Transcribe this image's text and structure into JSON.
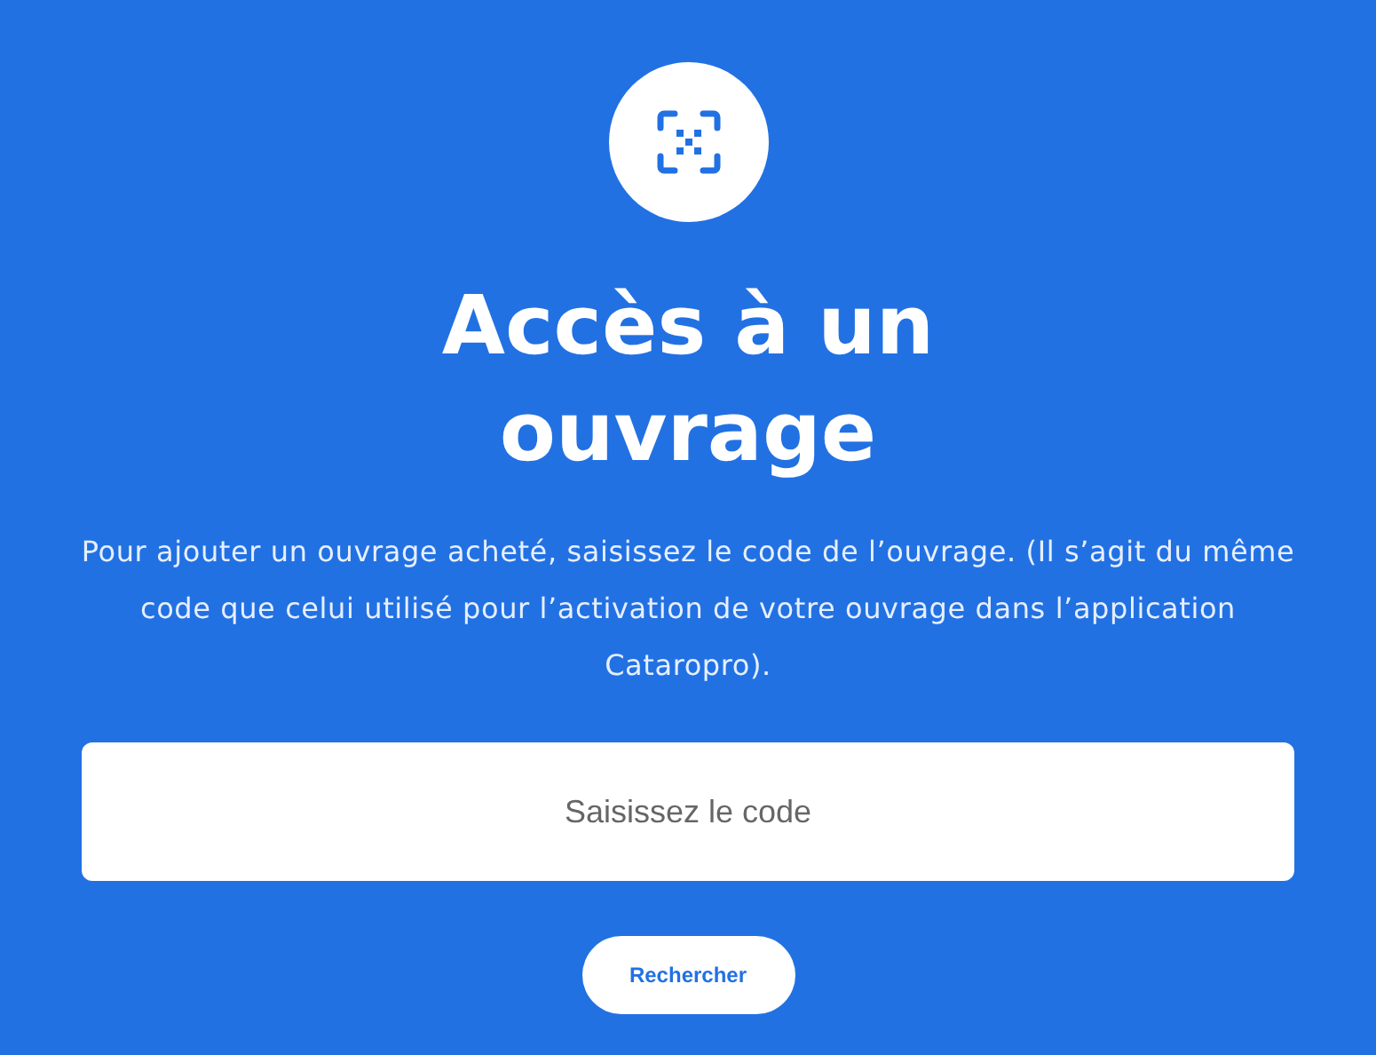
{
  "title": "Accès à un ouvrage",
  "description": "Pour ajouter un ouvrage acheté, saisissez le code de l’ouvrage. (Il s’agit du même code que celui utilisé pour l’activation de votre ouvrage dans l’application Cataropro).",
  "code_field": {
    "placeholder": "Saisissez le code"
  },
  "search_button": "Rechercher"
}
